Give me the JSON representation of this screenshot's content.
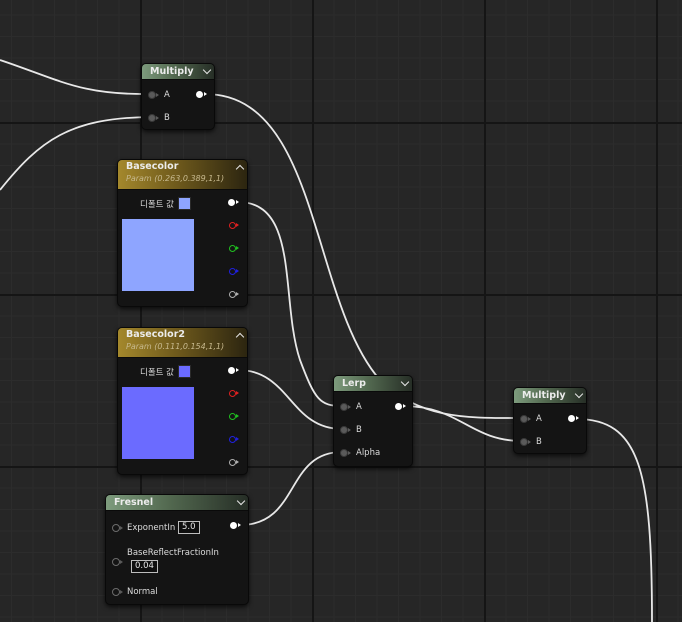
{
  "colors": {
    "basecolor": "#8ea5ff",
    "basecolor2": "#6b6bff"
  },
  "nodes": {
    "multiply1": {
      "title": "Multiply",
      "pin_a": "A",
      "pin_b": "B"
    },
    "basecolor": {
      "title": "Basecolor",
      "subtitle": "Param (0.263,0.389,1,1)",
      "default_label": "디폴트 값"
    },
    "basecolor2": {
      "title": "Basecolor2",
      "subtitle": "Param (0.111,0.154,1,1)",
      "default_label": "디폴트 값"
    },
    "lerp": {
      "title": "Lerp",
      "pin_a": "A",
      "pin_b": "B",
      "pin_alpha": "Alpha"
    },
    "multiply2": {
      "title": "Multiply",
      "pin_a": "A",
      "pin_b": "B"
    },
    "fresnel": {
      "title": "Fresnel",
      "exponent_label": "ExponentIn",
      "exponent_value": "5.0",
      "base_reflect_label": "BaseReflectFractionIn",
      "base_reflect_value": "0.04",
      "normal_label": "Normal"
    }
  }
}
